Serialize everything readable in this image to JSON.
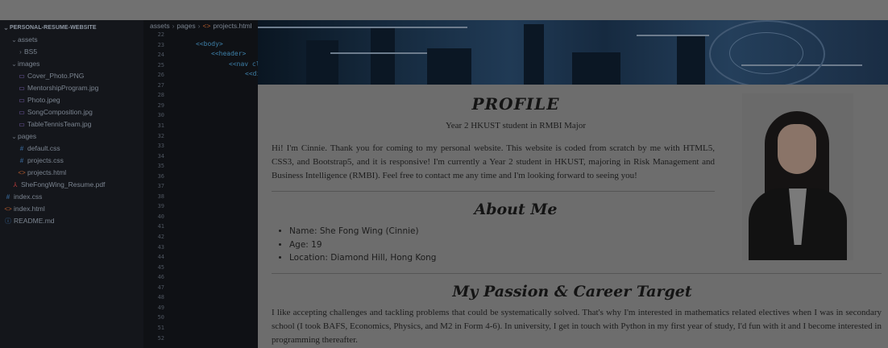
{
  "editor": {
    "explorer": {
      "root": "PERSONAL-RESUME-WEBSITE",
      "items": [
        {
          "label": "assets",
          "kind": "folder-open",
          "icon": "chevron-down-icon"
        },
        {
          "label": "BS5",
          "kind": "folder",
          "icon": "chevron-right-icon"
        },
        {
          "label": "images",
          "kind": "folder-open",
          "icon": "chevron-down-icon"
        },
        {
          "label": "Cover_Photo.PNG",
          "kind": "image",
          "icon": "image-file-icon"
        },
        {
          "label": "MentorshipProgram.jpg",
          "kind": "image",
          "icon": "image-file-icon"
        },
        {
          "label": "Photo.jpeg",
          "kind": "image",
          "icon": "image-file-icon"
        },
        {
          "label": "SongComposition.jpg",
          "kind": "image",
          "icon": "image-file-icon"
        },
        {
          "label": "TableTennisTeam.jpg",
          "kind": "image",
          "icon": "image-file-icon"
        },
        {
          "label": "pages",
          "kind": "folder-open",
          "icon": "chevron-down-icon"
        },
        {
          "label": "default.css",
          "kind": "css",
          "icon": "css-file-icon"
        },
        {
          "label": "projects.css",
          "kind": "css",
          "icon": "css-file-icon"
        },
        {
          "label": "projects.html",
          "kind": "html",
          "icon": "html-file-icon"
        },
        {
          "label": "SheFongWing_Resume.pdf",
          "kind": "pdf",
          "icon": "pdf-file-icon"
        },
        {
          "label": "index.css",
          "kind": "css",
          "icon": "css-file-icon"
        },
        {
          "label": "index.html",
          "kind": "html",
          "icon": "html-file-icon"
        },
        {
          "label": "README.md",
          "kind": "info",
          "icon": "info-file-icon"
        }
      ]
    },
    "breadcrumb": [
      "assets",
      "pages",
      "projects.html"
    ],
    "line_numbers": [
      "22",
      "23",
      "24",
      "25",
      "26",
      "27",
      "28",
      "29",
      "30",
      "31",
      "32",
      "33",
      "34",
      "35",
      "36",
      "37",
      "38",
      "39",
      "40",
      "41",
      "42",
      "43",
      "44",
      "45",
      "46",
      "47",
      "48",
      "49",
      "50",
      "51",
      "52"
    ],
    "code": [
      "<body>",
      "<header>",
      "<nav cl",
      "<di"
    ]
  },
  "page": {
    "profile_title": "PROFILE",
    "profile_subtitle": "Year 2 HKUST student in RMBI Major",
    "intro": "Hi! I'm Cinnie. Thank you for coming to my personal website. This website is coded from scratch by me with HTML5, CSS3, and Bootstrap5, and it is responsive! I'm currently a Year 2 student in HKUST, majoring in Risk Management and Business Intelligence (RMBI). Feel free to contact me any time and I'm looking forward to seeing you!",
    "about_title": "About Me",
    "about_items": [
      "Name: She Fong Wing (Cinnie)",
      "Age: 19",
      "Location: Diamond Hill, Hong Kong"
    ],
    "passion_title": "My Passion & Career Target",
    "passion_text": "I like accepting challenges and tackling problems that could be systematically solved. That's why I'm interested in mathematics related electives when I was in secondary school (I took BAFS, Economics, Physics, and M2 in Form 4-6). In university, I get in touch with Python in my first year of study, I'd fun with it and I become interested in programming thereafter."
  }
}
